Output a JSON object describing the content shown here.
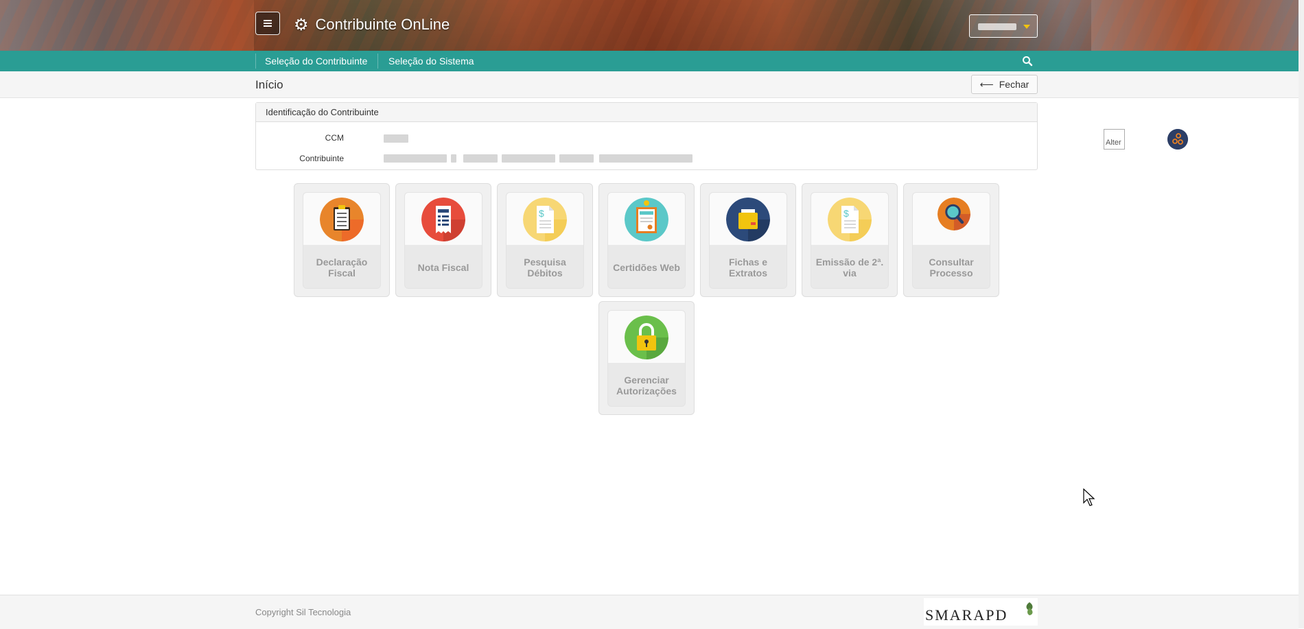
{
  "header": {
    "app_title": "Contribuinte OnLine",
    "menu_icon": "hamburger-icon",
    "title_icon": "gear-icon"
  },
  "nav": {
    "items": [
      {
        "label": "Seleção do Contribuinte"
      },
      {
        "label": "Seleção do Sistema"
      }
    ],
    "search_icon": "search-icon"
  },
  "breadcrumb": {
    "title": "Início",
    "close_label": "Fechar"
  },
  "panel": {
    "title": "Identificação do Contribuinte",
    "ccm_label": "CCM",
    "contribuinte_label": "Contribuinte",
    "broken_image_alt": "Alter"
  },
  "tiles": [
    {
      "label": "Declaração Fiscal",
      "icon": "clipboard-checklist-icon",
      "color": "#e67e22"
    },
    {
      "label": "Nota Fiscal",
      "icon": "receipt-icon",
      "color": "#e74c3c"
    },
    {
      "label": "Pesquisa Débitos",
      "icon": "dollar-document-icon",
      "color": "#f7d774"
    },
    {
      "label": "Certidões Web",
      "icon": "certificate-icon",
      "color": "#5bc8c8"
    },
    {
      "label": "Fichas e Extratos",
      "icon": "folder-icon",
      "color": "#2c4a7a"
    },
    {
      "label": "Emissão de 2ª. via",
      "icon": "dollar-document-icon",
      "color": "#f7d774"
    },
    {
      "label": "Consultar Processo",
      "icon": "magnifier-icon",
      "color": "#e67e22"
    },
    {
      "label": "Gerenciar Autorizações",
      "icon": "padlock-icon",
      "color": "#6abf4b"
    }
  ],
  "footer": {
    "copyright": "Copyright Sil Tecnologia",
    "logo_text": "SMARAPD"
  },
  "colors": {
    "nav_bg": "#2a9d94",
    "accent": "#f1c40f"
  }
}
